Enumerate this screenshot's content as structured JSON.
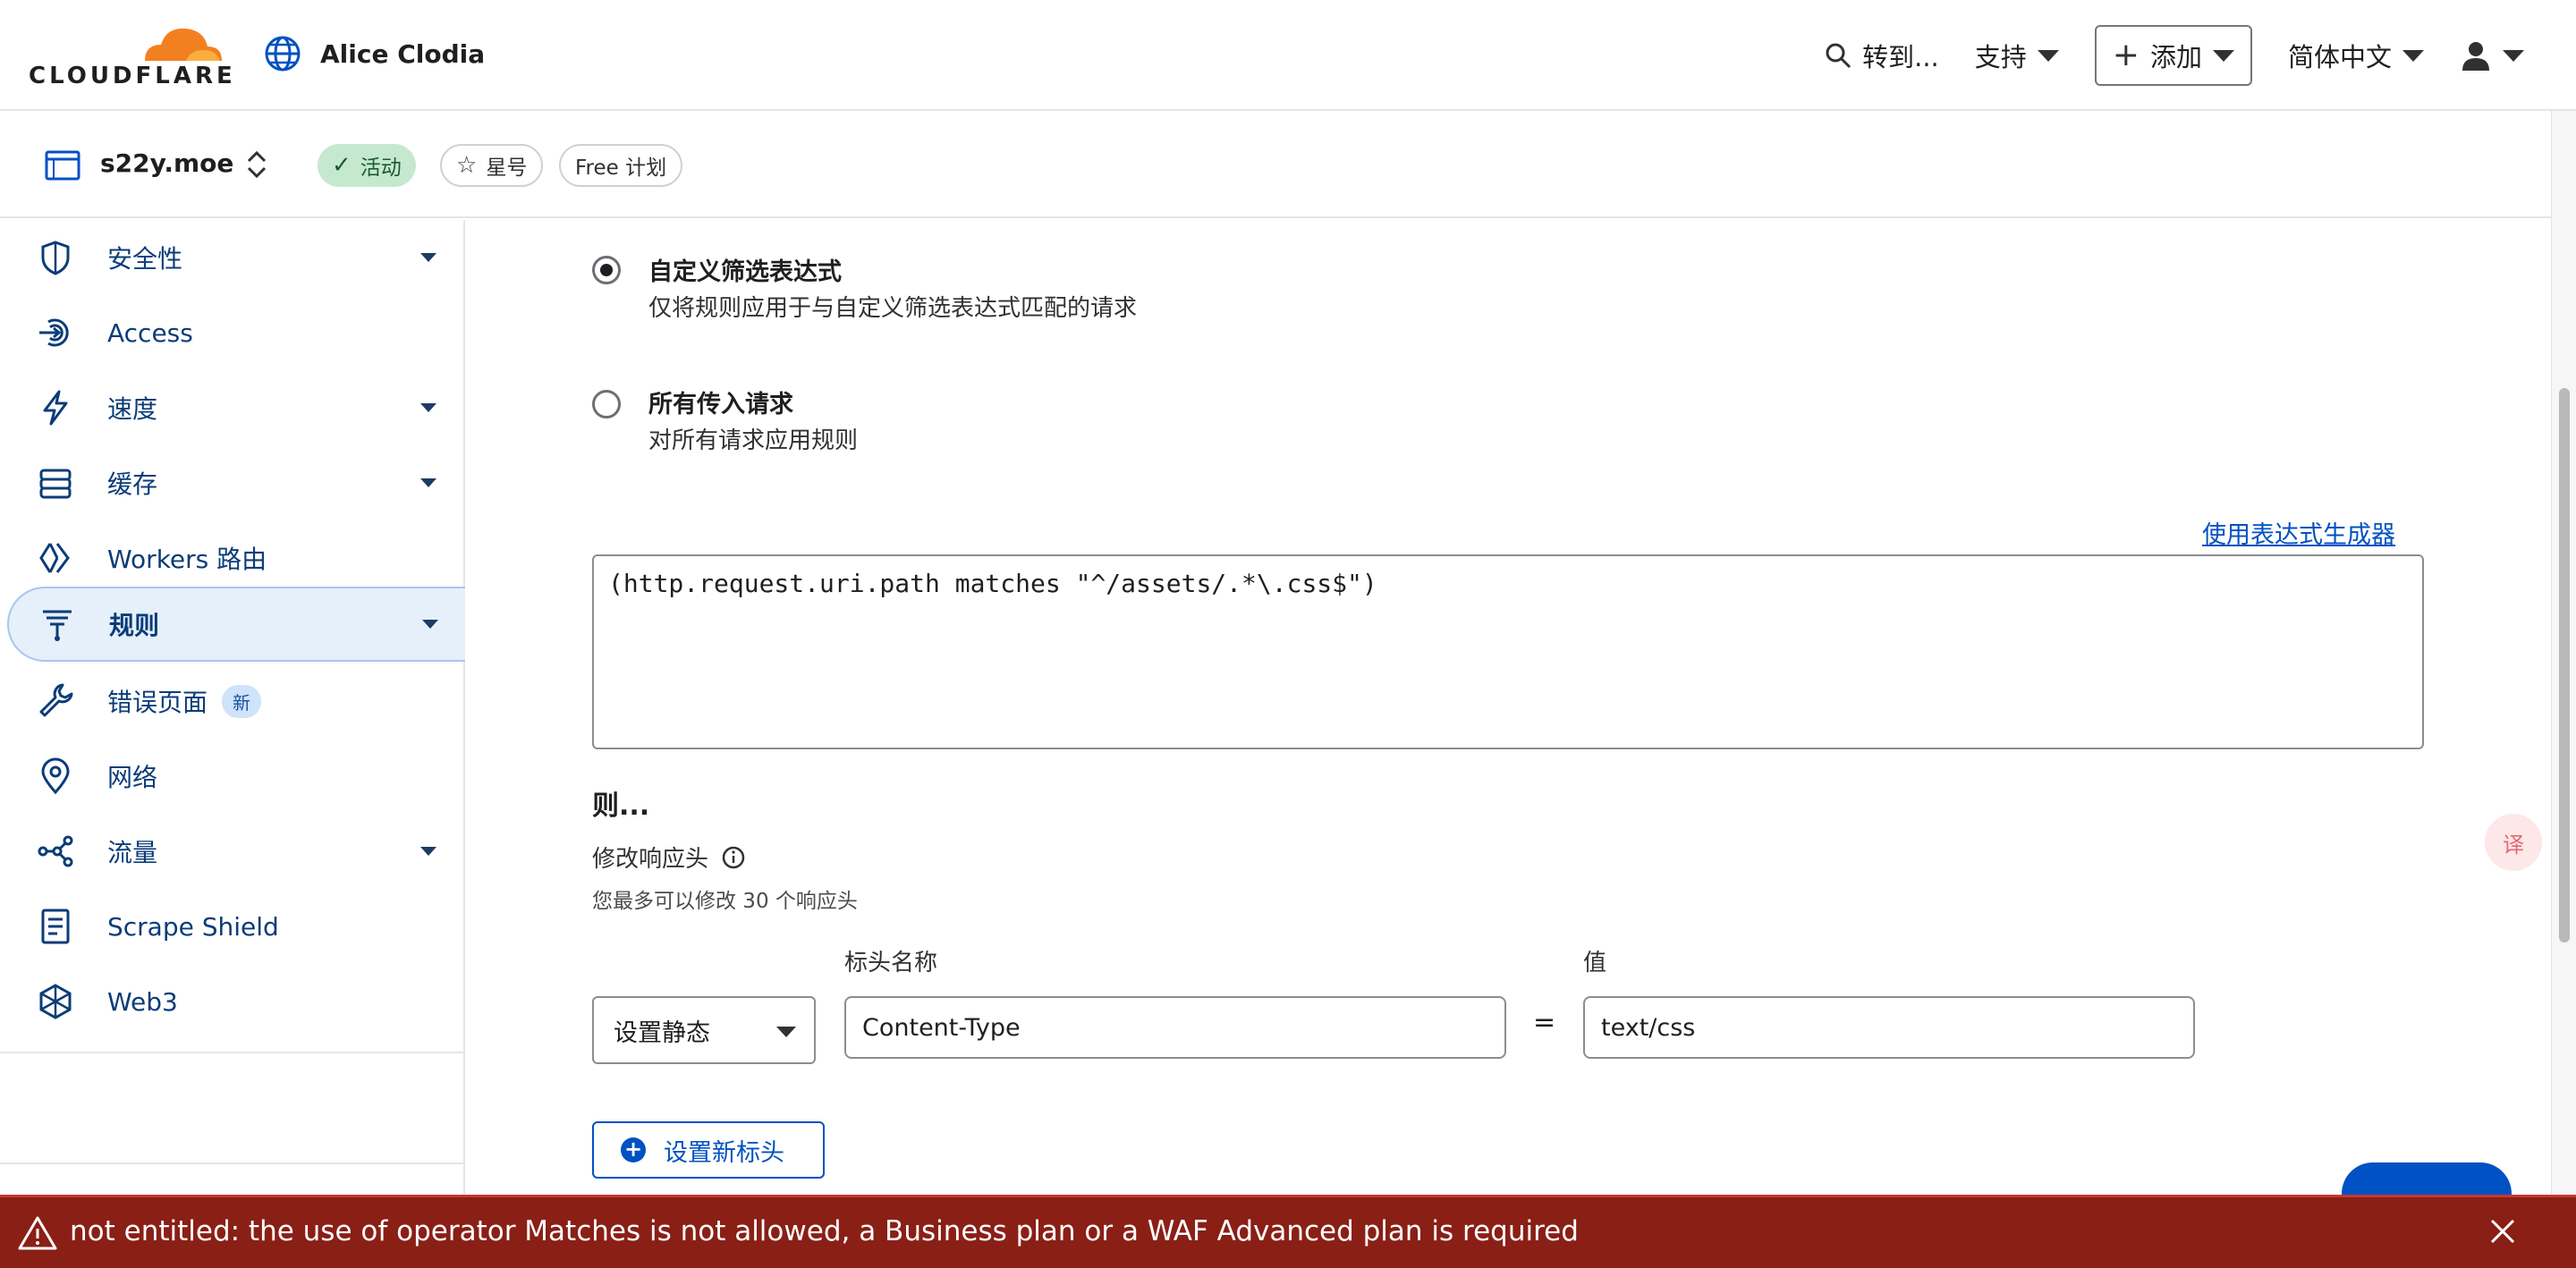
{
  "header": {
    "logo_text": "CLOUDFLARE",
    "account_name": "Alice Clodia",
    "search_label": "转到...",
    "support_label": "支持",
    "add_label": "添加",
    "language_label": "简体中文"
  },
  "zone": {
    "name": "s22y.moe",
    "status": "活动",
    "star_label": "星号",
    "plan": "Free 计划"
  },
  "sidebar": {
    "items": [
      {
        "label": "安全性",
        "icon": "shield-icon",
        "dropdown": true
      },
      {
        "label": "Access",
        "icon": "access-icon",
        "dropdown": false
      },
      {
        "label": "速度",
        "icon": "lightning-icon",
        "dropdown": true
      },
      {
        "label": "缓存",
        "icon": "cache-icon",
        "dropdown": true
      },
      {
        "label": "Workers 路由",
        "icon": "workers-icon",
        "dropdown": false
      },
      {
        "label": "规则",
        "icon": "rules-icon",
        "dropdown": true,
        "selected": true
      },
      {
        "label": "错误页面",
        "icon": "wrench-icon",
        "dropdown": false,
        "badge": "新"
      },
      {
        "label": "网络",
        "icon": "location-pin-icon",
        "dropdown": false
      },
      {
        "label": "流量",
        "icon": "traffic-icon",
        "dropdown": true
      },
      {
        "label": "Scrape Shield",
        "icon": "document-icon",
        "dropdown": false
      },
      {
        "label": "Web3",
        "icon": "web3-icon",
        "dropdown": false
      }
    ]
  },
  "filter": {
    "custom_title": "自定义筛选表达式",
    "custom_desc": "仅将规则应用于与自定义筛选表达式匹配的请求",
    "all_title": "所有传入请求",
    "all_desc": "对所有请求应用规则",
    "selected": "custom",
    "builder_link": "使用表达式生成器",
    "expression": "(http.request.uri.path matches \"^/assets/.*\\.css$\")"
  },
  "then": {
    "title": "则...",
    "modify_label": "修改响应头",
    "limit_note": "您最多可以修改 30 个响应头",
    "header_name_label": "标头名称",
    "value_label": "值",
    "operation": "设置静态",
    "header_name": "Content-Type",
    "equals": "=",
    "header_value": "text/css",
    "add_header_label": "设置新标头"
  },
  "alert": {
    "message": "not entitled: the use of operator Matches is not allowed, a Business plan or a WAF Advanced plan is required"
  },
  "colors": {
    "accent": "#0051c3",
    "alert_bg": "#8a1f16",
    "logo_orange": "#f38020",
    "active_green": "#c5e9cf"
  }
}
